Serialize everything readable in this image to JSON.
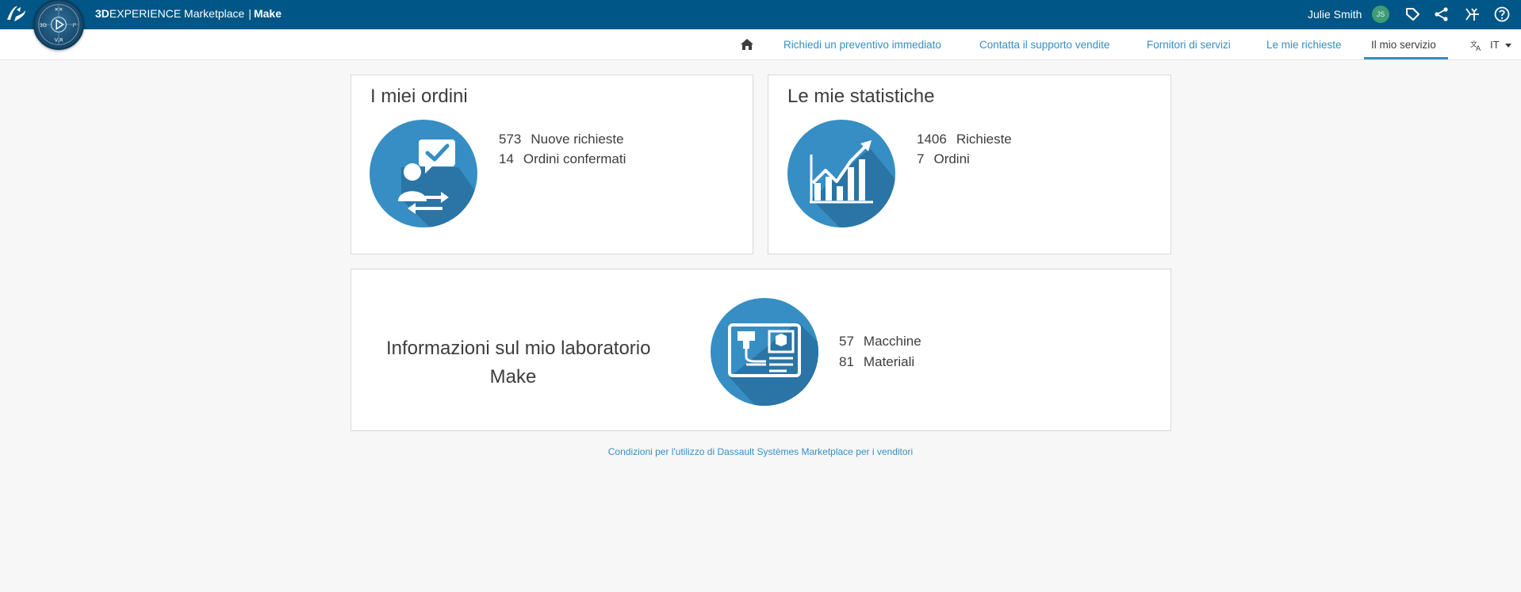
{
  "header": {
    "brand_prefix": "3D",
    "brand_name": "EXPERIENCE Marketplace",
    "brand_separator": "|",
    "app_name": "Make",
    "compass_labels": {
      "top": "✕✕",
      "left": "3D",
      "right": "i²",
      "bottom": "V,R"
    },
    "user_name": "Julie Smith",
    "user_initials": "JS",
    "icons": [
      "tag-icon",
      "share-icon",
      "compass-apps-icon",
      "help-icon"
    ]
  },
  "nav": {
    "items": [
      {
        "label": "Richiedi un preventivo immediato"
      },
      {
        "label": "Contatta il supporto vendite"
      },
      {
        "label": "Fornitori di servizi"
      },
      {
        "label": "Le mie richieste"
      },
      {
        "label": "Il mio servizio"
      }
    ],
    "active_index": 4,
    "language": "IT"
  },
  "orders_card": {
    "title": "I miei ordini",
    "stats": [
      {
        "value": "573",
        "label": "Nuove richieste"
      },
      {
        "value": "14",
        "label": "Ordini confermati"
      }
    ]
  },
  "stats_card": {
    "title": "Le mie statistiche",
    "stats": [
      {
        "value": "1406",
        "label": "Richieste"
      },
      {
        "value": "7",
        "label": "Ordini"
      }
    ]
  },
  "lab_card": {
    "title_line1": "Informazioni sul mio laboratorio",
    "title_line2": "Make",
    "stats": [
      {
        "value": "57",
        "label": "Macchine"
      },
      {
        "value": "81",
        "label": "Materiali"
      }
    ]
  },
  "footer": {
    "link_text": "Condizioni per l'utilizzo di Dassault Systèmes Marketplace per i venditori"
  },
  "colors": {
    "header_bg": "#005686",
    "accent": "#368ec4",
    "badge": "#368ec4",
    "badge_shadow": "#2a74a6",
    "avatar": "#3f9c74",
    "page_bg": "#f7f7f7"
  }
}
